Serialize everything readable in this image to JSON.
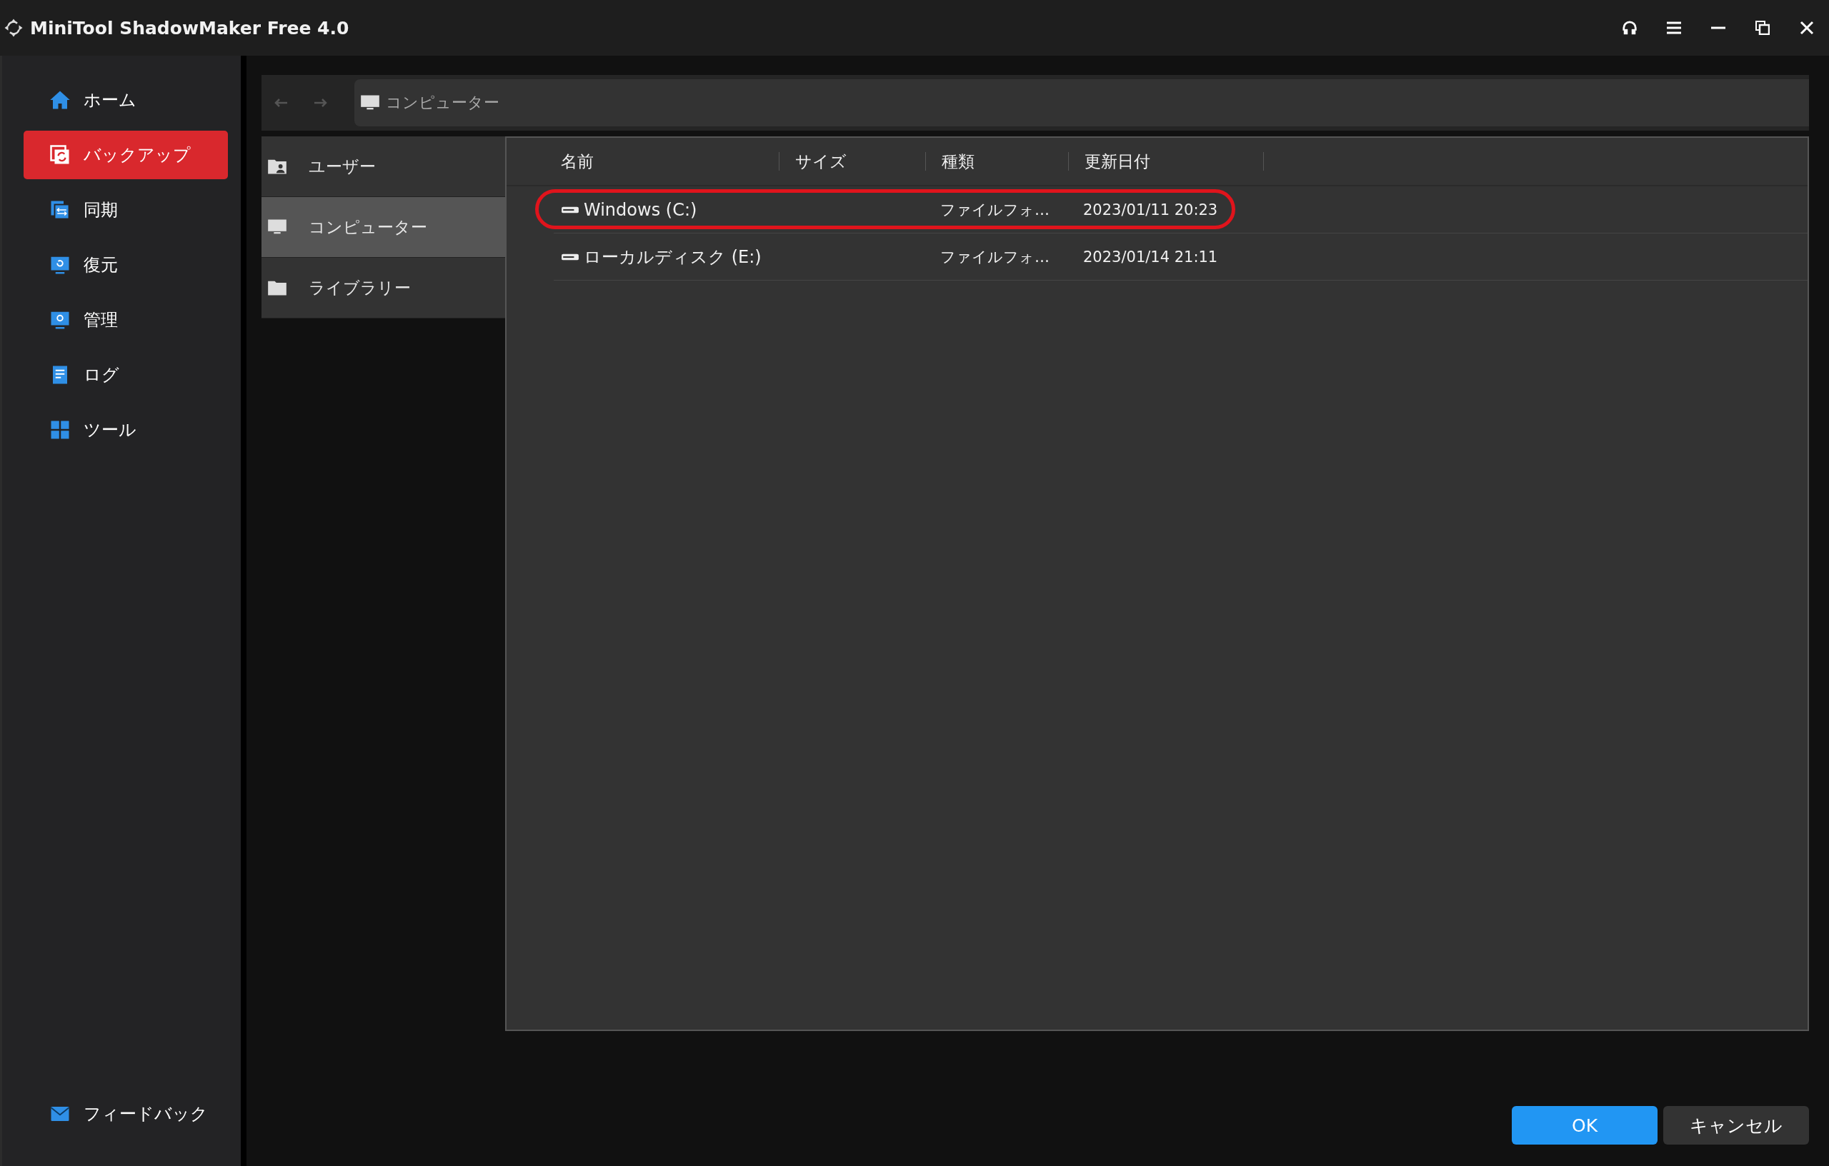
{
  "window": {
    "title": "MiniTool ShadowMaker Free 4.0"
  },
  "sidebar": {
    "items": [
      {
        "label": "ホーム",
        "selected": false
      },
      {
        "label": "バックアップ",
        "selected": true
      },
      {
        "label": "同期",
        "selected": false
      },
      {
        "label": "復元",
        "selected": false
      },
      {
        "label": "管理",
        "selected": false
      },
      {
        "label": "ログ",
        "selected": false
      },
      {
        "label": "ツール",
        "selected": false
      }
    ],
    "footer": {
      "label": "フィードバック"
    }
  },
  "browser": {
    "path": "コンピューター",
    "places": [
      {
        "label": "ユーザー",
        "selected": false
      },
      {
        "label": "コンピューター",
        "selected": true
      },
      {
        "label": "ライブラリー",
        "selected": false
      }
    ],
    "table": {
      "columns": [
        "名前",
        "サイズ",
        "種類",
        "更新日付"
      ],
      "rows": [
        {
          "name": "Windows (C:)",
          "type": "ファイルフォ…",
          "modified": "2023/01/11 20:23",
          "highlighted": true
        },
        {
          "name": "ローカルディスク (E:)",
          "type": "ファイルフォ…",
          "modified": "2023/01/14 21:11",
          "highlighted": false
        }
      ]
    }
  },
  "buttons": {
    "ok": "OK",
    "cancel": "キャンセル"
  }
}
